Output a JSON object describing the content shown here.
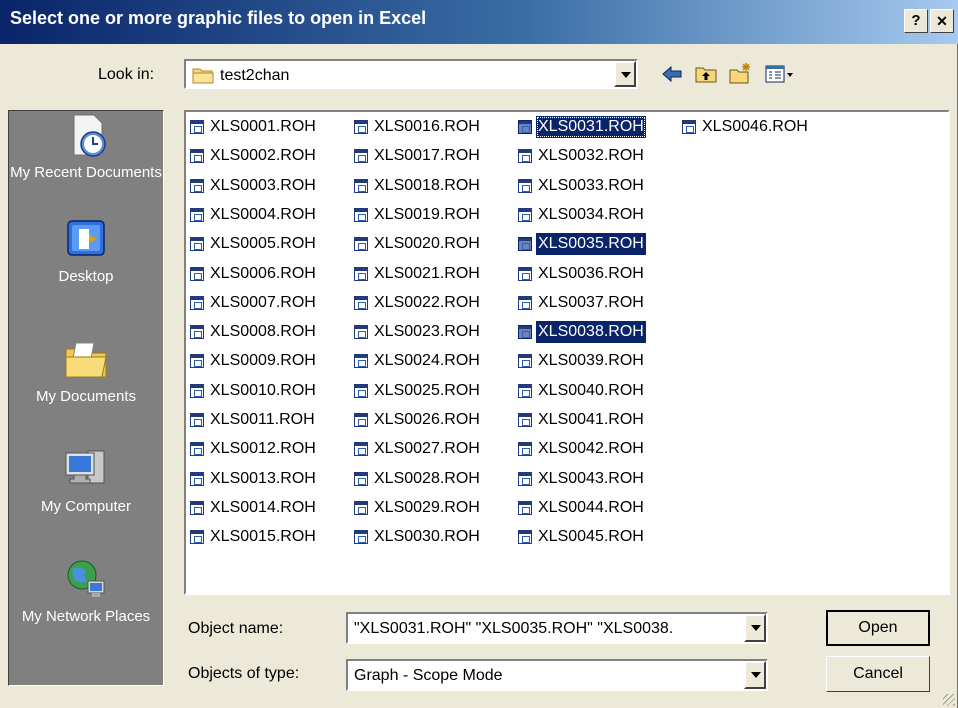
{
  "window": {
    "title": "Select one or more graphic files to open in Excel",
    "help_label": "?",
    "close_label": "✕"
  },
  "look_in": {
    "label": "Look in:",
    "value": "test2chan"
  },
  "places": [
    {
      "label": "My Recent Documents",
      "icon": "recent-documents-icon"
    },
    {
      "label": "Desktop",
      "icon": "desktop-icon"
    },
    {
      "label": "My Documents",
      "icon": "my-documents-icon"
    },
    {
      "label": "My Computer",
      "icon": "my-computer-icon"
    },
    {
      "label": "My Network Places",
      "icon": "network-places-icon"
    }
  ],
  "files": [
    "XLS0001.ROH",
    "XLS0002.ROH",
    "XLS0003.ROH",
    "XLS0004.ROH",
    "XLS0005.ROH",
    "XLS0006.ROH",
    "XLS0007.ROH",
    "XLS0008.ROH",
    "XLS0009.ROH",
    "XLS0010.ROH",
    "XLS0011.ROH",
    "XLS0012.ROH",
    "XLS0013.ROH",
    "XLS0014.ROH",
    "XLS0015.ROH",
    "XLS0016.ROH",
    "XLS0017.ROH",
    "XLS0018.ROH",
    "XLS0019.ROH",
    "XLS0020.ROH",
    "XLS0021.ROH",
    "XLS0022.ROH",
    "XLS0023.ROH",
    "XLS0024.ROH",
    "XLS0025.ROH",
    "XLS0026.ROH",
    "XLS0027.ROH",
    "XLS0028.ROH",
    "XLS0029.ROH",
    "XLS0030.ROH",
    "XLS0031.ROH",
    "XLS0032.ROH",
    "XLS0033.ROH",
    "XLS0034.ROH",
    "XLS0035.ROH",
    "XLS0036.ROH",
    "XLS0037.ROH",
    "XLS0038.ROH",
    "XLS0039.ROH",
    "XLS0040.ROH",
    "XLS0041.ROH",
    "XLS0042.ROH",
    "XLS0043.ROH",
    "XLS0044.ROH",
    "XLS0045.ROH",
    "XLS0046.ROH"
  ],
  "selected_files": [
    "XLS0031.ROH",
    "XLS0035.ROH",
    "XLS0038.ROH"
  ],
  "focused_file": "XLS0031.ROH",
  "object_name": {
    "label": "Object name:",
    "value": "\"XLS0031.ROH\" \"XLS0035.ROH\" \"XLS0038."
  },
  "object_type": {
    "label": "Objects of type:",
    "value": "Graph - Scope Mode"
  },
  "buttons": {
    "open": "Open",
    "cancel": "Cancel"
  },
  "colors": {
    "selection": "#0a246a",
    "places_bar": "#808080",
    "dialog_face": "#ece9d8"
  }
}
